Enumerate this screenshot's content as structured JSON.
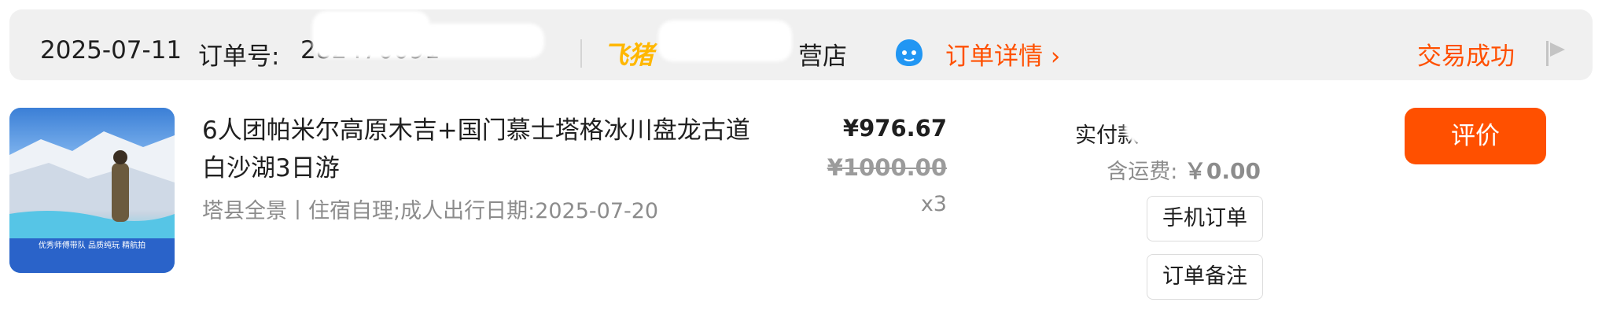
{
  "header": {
    "date": "2025-07-11",
    "order_label": "订单号:",
    "order_number": "282470091",
    "platform": "飞猪",
    "shop_name_suffix": "营店",
    "order_detail_link": "订单详情 ›",
    "status": "交易成功"
  },
  "product": {
    "title": "6人团帕米尔高原木吉+国门慕士塔格冰川盘龙古道白沙湖3日游",
    "sku": "塔县全景丨住宿自理;成人出行日期:2025-07-20",
    "price": "¥976.67",
    "original_price": "¥1000.00",
    "quantity": "x3",
    "thumbnail_caption": "优秀师傅带队  品质纯玩  精航拍"
  },
  "payment": {
    "paid_label": "实付款",
    "shipping_label": "含运费:",
    "shipping_amount": "￥0.00"
  },
  "actions": {
    "mobile_order": "手机订单",
    "order_note": "订单备注",
    "review": "评价"
  },
  "colors": {
    "accent": "#ff5000",
    "brand_fliggy": "#ffb700",
    "chat_icon": "#2196f3"
  }
}
